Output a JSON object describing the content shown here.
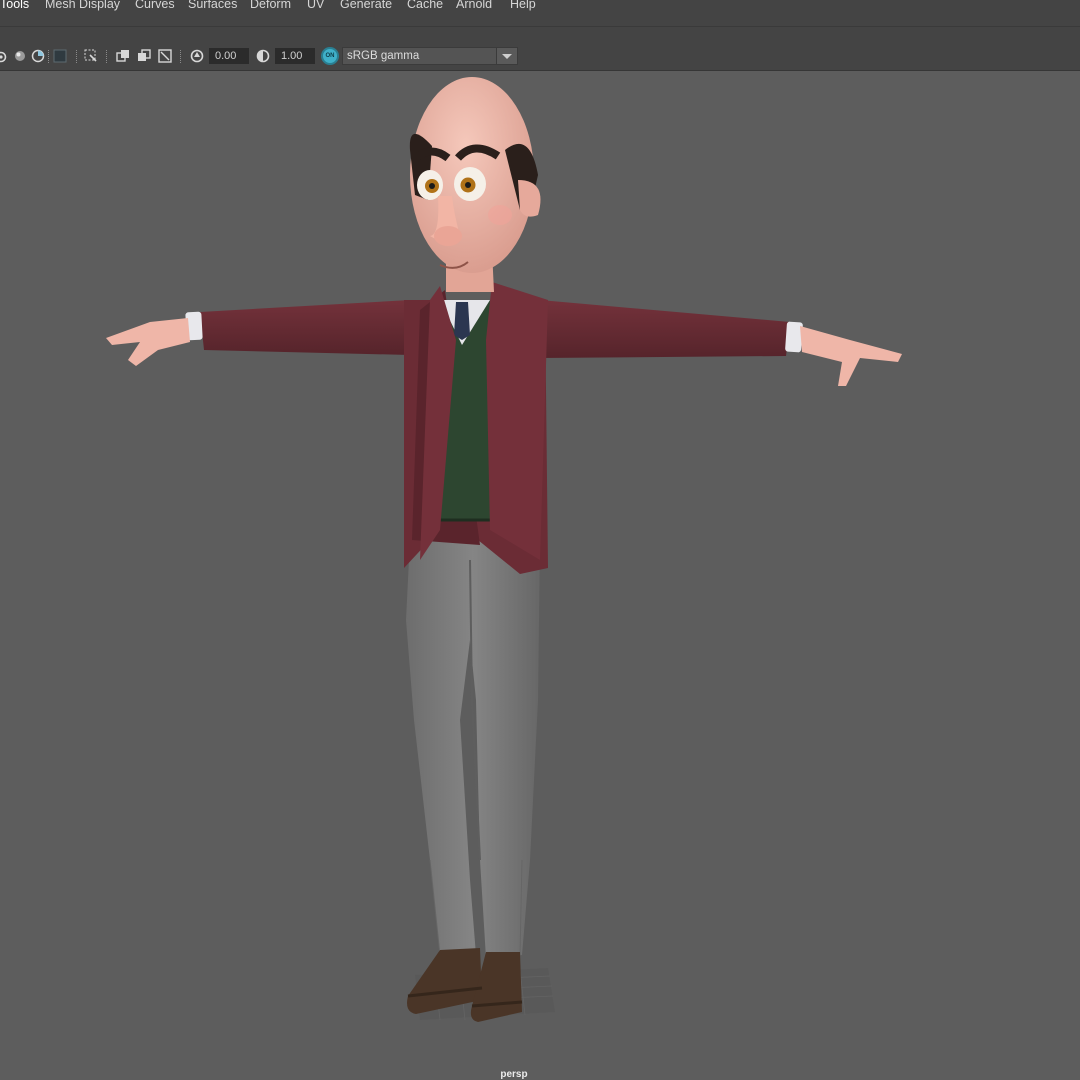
{
  "menubar": {
    "items": [
      "Tools",
      "Mesh Display",
      "Curves",
      "Surfaces",
      "Deform",
      "UV",
      "Generate",
      "Cache",
      "Arnold",
      "Help"
    ]
  },
  "toolbar": {
    "icons": [
      "camera-tumble-icon",
      "isolate-select-icon",
      "grid-toggle-icon",
      "xray-icon",
      "resolution-gate-icon",
      "gate-mask-icon",
      "film-gate-icon",
      "safe-action-icon",
      "exposure-icon",
      "gamma-icon"
    ],
    "exposure_value": "0.00",
    "gamma_value": "1.00",
    "color_management_label": "ON",
    "view_transform": "sRGB gamma"
  },
  "viewport": {
    "camera_name": "persp",
    "background_color": "#5d5d5d"
  },
  "colors": {
    "ui_panel": "#444444",
    "field_bg": "#2b2b2b",
    "accent": "#3fb0c9",
    "jacket": "#6b2c35",
    "sweater": "#2d4630",
    "pants": "#7b7b7b",
    "shoes": "#4a3527",
    "skin": "#efb6a8"
  }
}
